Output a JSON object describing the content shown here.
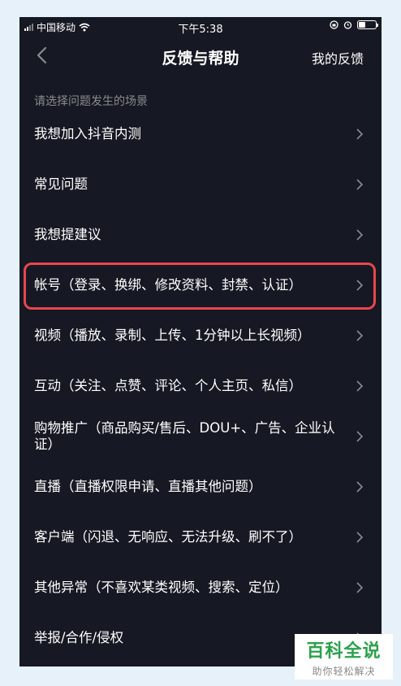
{
  "status_bar": {
    "carrier": "中国移动",
    "time": "下午5:38"
  },
  "nav": {
    "title": "反馈与帮助",
    "right_label": "我的反馈",
    "back_icon": "chevron-left-icon"
  },
  "section_label": "请选择问题发生的场景",
  "items": [
    {
      "label": "我想加入抖音内测"
    },
    {
      "label": "常见问题"
    },
    {
      "label": "我想提建议"
    },
    {
      "label": "帐号（登录、换绑、修改资料、封禁、认证）"
    },
    {
      "label": "视频（播放、录制、上传、1分钟以上长视频）"
    },
    {
      "label": "互动（关注、点赞、评论、个人主页、私信）"
    },
    {
      "label": "购物推广（商品购买/售后、DOU+、广告、企业认证）"
    },
    {
      "label": "直播（直播权限申请、直播其他问题）"
    },
    {
      "label": "客户端（闪退、无响应、无法升级、刷不了）"
    },
    {
      "label": "其他异常（不喜欢某类视频、搜索、定位）"
    },
    {
      "label": "举报/合作/侵权"
    }
  ],
  "highlight_index": 3,
  "watermark": {
    "main": "百科全说",
    "sub": "助你轻松解决"
  },
  "colors": {
    "background": "#161823",
    "highlight_border": "#e8474a",
    "watermark_green": "#2aa14a"
  }
}
